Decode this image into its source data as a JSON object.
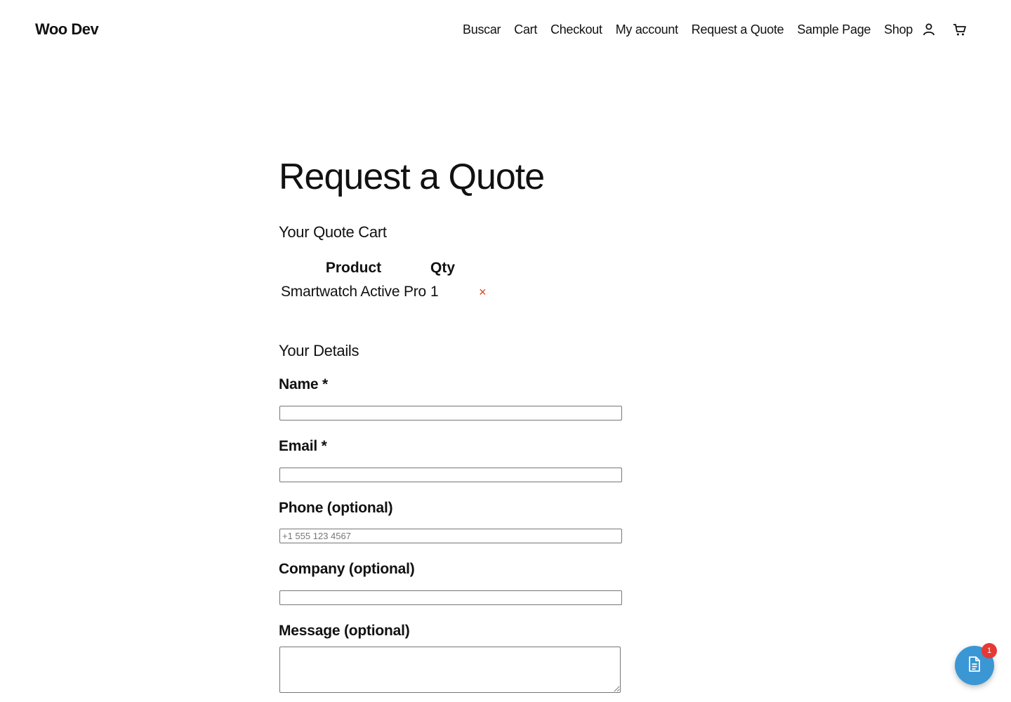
{
  "header": {
    "site_title": "Woo Dev",
    "nav": [
      "Buscar",
      "Cart",
      "Checkout",
      "My account",
      "Request a Quote",
      "Sample Page",
      "Shop"
    ]
  },
  "main": {
    "page_title": "Request a Quote",
    "quote_cart": {
      "heading": "Your Quote Cart",
      "columns": {
        "product": "Product",
        "qty": "Qty"
      },
      "rows": [
        {
          "product": "Smartwatch Active Pro",
          "qty": "1",
          "remove": "×"
        }
      ]
    },
    "details": {
      "heading": "Your Details",
      "name_label": "Name *",
      "name_value": "",
      "email_label": "Email *",
      "email_value": "",
      "phone_label": "Phone (optional)",
      "phone_placeholder": "+1 555 123 4567",
      "company_label": "Company (optional)",
      "company_value": "",
      "message_label": "Message (optional)",
      "message_value": ""
    }
  },
  "floating_quote": {
    "icon": "document-icon",
    "badge": "1",
    "color": "#3a97d4",
    "badge_color": "#e53935"
  },
  "icons": {
    "account": "user-icon",
    "cart": "cart-icon",
    "remove": "close-icon"
  },
  "colors": {
    "text": "#111111",
    "remove": "#e2401c"
  }
}
